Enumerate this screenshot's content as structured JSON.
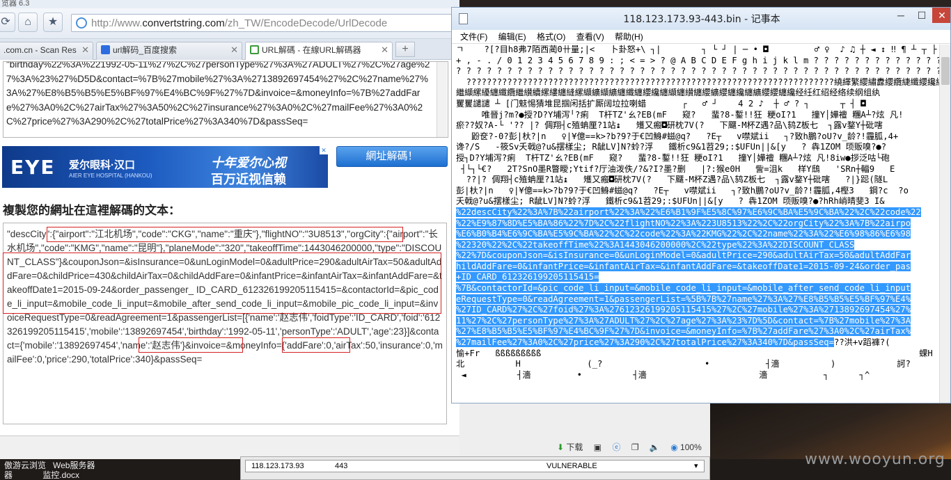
{
  "browser": {
    "window_title": "览器 6.3",
    "address_url_prefix": "http://www.",
    "address_url_domain": "convertstring.com",
    "address_url_path": "/zh_TW/EncodeDecode/UrlDecode",
    "tabs": [
      {
        "label": ".com.cn - Scan Res",
        "active": false
      },
      {
        "label": "url解码_百度搜索",
        "active": false
      },
      {
        "label": "URL解碼 - 在線URL解碼器",
        "active": true
      }
    ],
    "new_tab_label": "+",
    "top_textarea_text": "\"birthday%22%3A%221992-05-11%27%2C%27personType%27%3A%27ADULT%27%2C%27age%27%3A%23%27%D5D&contact=%7B%27mobile%27%3A%2713892697454%27%2C%27name%27%3A%27%E8%B5%B5%E5%BF%97%E4%BC%9F%27%7D&invoice=&moneyInfo=%7B%27addFare%27%3A0%2C%27airTax%27%3A50%2C%27insurance%27%3A0%2C%27mailFee%27%3A0%2C%27price%27%3A290%2C%27totalPrice%27%3A340%7D&passSeq=",
    "decode_button": "網址解碼！",
    "heading": "複製您的網址在這裡解碼的文本：",
    "result_text": "\"descCity\":{\"airport\":\"江北机场\",\"code\":\"CKG\",\"name\":\"重庆\"},\"flightNO\":\"3U8513\",\"orgCity\":{\"airport\":\"长水机场\",\"code\":\"KMG\",\"name\":\"昆明\"},\"planeMode\":\"320\",\"takeoffTime\":1443046200000,\"type\":\"DISCOUNT_CLASS\"}&couponJson=&isInsurance=0&unLoginModel=0&adultPrice=290&adultAirTax=50&adultAddFare=0&childPrice=430&childAirTax=0&childAddFare=0&infantPrice=&infantAirTax=&infantAddFare=&takeoffDate1=2015-09-24&order_passenger_ ID_CARD_612326199205115415=&contactorId=&pic_code_li_input=&mobile_code_li_input=&mobile_after_send_code_li_input=&mobile_pic_code_li_input=&invoiceRequestType=0&readAgreement=1&passengerList=[{'name':'赵志伟','foidType':'ID_CARD','foid':'612326199205115415','mobile':'13892697454','birthday':'1992-05-11','personType':'ADULT','age':23}]&contact={'mobile':'13892697454','name':'赵志伟'}&invoice=&moneyInfo={'addFare':0,'airTax':50,'insurance':0,'mailFee':0,'price':290,'totalPrice':340}&passSeq=",
    "status_download": "下载",
    "status_zoom": "100%"
  },
  "banner": {
    "logo": "EYE",
    "name_cn": "爱尔眼科·汉口",
    "name_en": "AIER EYE HOSPITAL (HANKOU)",
    "slogan1": "十年爱尔心视",
    "slogan2": "百万近视信赖",
    "ad_mark": "✕"
  },
  "notepad": {
    "title": "118.123.173.93-443.bin - 记事本",
    "menu": [
      "文件(F)",
      "编辑(E)",
      "格式(O)",
      "查看(V)",
      "帮助(H)"
    ],
    "lines": [
      {
        "text": "ㄱ    ?[?目h8弗7陌西蔺0卄量;|<   卜卦怒+\\ ┐|        ┐ └ ┘ | ─ • ◘         ♂ ♀  ♪ ♫ ┼ ◄ ↕ ‼ ¶ ┴ ┬ ├",
        "sel": false
      },
      {
        "text": "+ , - . / 0 1 2 3 4 5 6 7 8 9 : ; < = > ? @ A B C D E F g h i j k l m ? ? ? ? ? ? ? ? ? ? ? ? ?",
        "sel": false
      },
      {
        "text": "? ? ? ? ? ? ? ? ? ? ? ? ? ? ? ? ? ? ? ? ? ? ? ? ? ? ? ? ? ? ? ? ? ? ? ? ? ? ? ? ? ? ? ? ? ? ? ? ? ?",
        "sel": false
      },
      {
        "text": "  ????????????????????????????????????????????????????????????????????????繞繹繁纓繡纛纓纜緁纖纓纔纓纗",
        "sel": false
      },
      {
        "text": "繼纈縲纋纏纖纜繼纉續縲縷纏縫縲纈纊纈纊纏纖纏纓纔纏纈纏纉纏纓纊纓纏纔纏纊纓纓纏纔经纴红绍经络续纲组纨",
        "sel": false
      },
      {
        "text": "矍矍譴譴 ┴ [门鬾惕猜堆昆掴闲括扩厮阔垃拉喇蜡       ┌   ♂ ┘    4 2 ♪  ┼ ♂ ? ┐      ┬ ┤ ◘",
        "sel": false
      },
      {
        "text": "     唯晉j?m?●授?D?Y埔泻╵?痢  T杆TZ'ㄠ?EB(mF   窥?   蜚?8-鏨!!狂 粳oI?1   撞Y│嬅襢 糰A┴?炫 凡!",
        "sel": false
      },
      {
        "text": "瘀??奴?A-└ '?? |? 倜翔┤c殖蚺厘?1站↨   矱又瘢◘研枕7V(?   下飅-M杯Z遇?品\\鸫Z板七  ┐露v鍪Y┼砒嗐",
        "sel": false
      },
      {
        "text": "   鼢奁?-0?彭|杕?|n   ♀|¥億==k>?b?9?于€凹鯓#螆@q?   ?E┬   v噤斌ii   ┐?致h鵬?oU?v_龄?!霾胍,4+",
        "sel": false
      },
      {
        "text": "谗?/S   -筱Sv夭戟@?u&摆樣尘; R龇LV]N?蛉?浮   鐵析c9&1苕29;:$UFUn||&[y   ? 犇1ZOM ̄顷贩嗅?●?",
        "sel": false
      },
      {
        "text": "授┐D?Y埔泻?痢  T杆TZ'ㄠ?EB(mF   窥?   蜚?8-鏨!!狂 粳oI?1   撞Y│嬅襢 糰A┴?炫 凡!8iw●拶泛咕└砲",
        "sel": false
      },
      {
        "text": " ┤└┐└€?   2T?SnO墨R瞥瞹;Ytif?厅油泼佚/?&?I?墨?删   |?:猴e0H   訾=沮k   样Y鴟   'SRn┼輻9   E",
        "sel": false
      },
      {
        "text": "  ??|? 倜翔┤c殖蚺厘?1站↨   矱又瘢◘研枕7V(?   下飅-M杯Z遇?品\\鸫Z板七  ┐露v鍪Y┼砒嗐   ?|}跽(隧L",
        "sel": false
      },
      {
        "text": "彭|杕?|n   ♀|¥億==k>?b?9?于€凹鯓#螆@q?   ?E┬   v噤斌ii   ┐?致h鵬?oU?v_龄?!霾胍,4樫3   鋼?c  ?o",
        "sel": false
      },
      {
        "text": "夭戟@?u&摆樣尘; R龇LV]N?蛉?浮   鐵析c9&1苕29;:$UFUn||&[y   ? 犇1ZOM ̄顷贩嗅?●?hRh峭晴斐3 I&",
        "sel": false
      },
      {
        "text": "%22descCity%22%3A%7B%22airport%22%3A%22%E6%B1%9F%E5%8C%97%E6%9C%BA%E5%9C%BA%22%2C%22code%22",
        "sel": true
      },
      {
        "text": "%22%E9%87%8D%E5%BA%86%22%7D%2C%22flightNO%22%3A%223U8513%22%2C%22orgCity%22%3A%7B%22airpo",
        "sel": true
      },
      {
        "text": "%E6%B0%B4%E6%9C%BA%E5%9C%BA%22%2C%22code%22%3A%22KMG%22%2C%22name%22%3A%22%E6%98%86%E6%98",
        "sel": true
      },
      {
        "text": "%22320%22%2C%22takeoffTime%22%3A1443046200000%2C%22type%22%3A%22DISCOUNT_CLASS",
        "sel": true
      },
      {
        "text": "%22%7D&couponJson=&isInsurance=0&unLoginModel=0&adultPrice=290&adultAirTax=50&adultAddFar",
        "sel": true
      },
      {
        "text": "hildAddFare=0&infantPrice=&infantAirTax=&infantAddFare=&takeoffDate1=2015-09-24&order_pas",
        "sel": true
      },
      {
        "text": "+ID_CARD_612326199205115415=",
        "sel": true
      },
      {
        "text": "%7B&contactorId=&pic_code_li_input=&mobile_code_li_input=&mobile_after_send_code_li_input",
        "sel": true
      },
      {
        "text": "eRequestType=0&readAgreement=1&passengerList=%5B%7B%27name%27%3A%27%E8%B5%B5%E5%BF%97%E4%",
        "sel": true
      },
      {
        "text": "%27ID_CARD%27%2C%27foid%27%3A%27612326199205115415%27%2C%27mobile%27%3A%2713892697454%27%",
        "sel": true
      },
      {
        "text": "11%27%2C%27personType%27%3A%27ADULT%27%2C%27age%27%3A%23%7D%5D&contact=%7B%27mobile%27%3A",
        "sel": true
      },
      {
        "text": "%27%E8%B5%B5%E5%BF%97%E4%BC%9F%27%7D&invoice=&moneyInfo=%7B%27addFare%27%3A0%2C%27airTax%",
        "sel": true
      },
      {
        "text": "%27mailFee%27%3A0%2C%27price%27%3A290%2C%27totalPrice%27%3A340%7D&passSeq=",
        "sel": true,
        "tail": "??洪+v蹈褲?("
      },
      {
        "text": "愉+Fr   ßßßßßßßßß                                                                          蜾H",
        "sel": false
      },
      {
        "text": "北          H             (_?                    •           ┤濇          )            訶?            ?",
        "sel": false
      },
      {
        "text": " ◄          ┤濇         •          ┤濇                      濇           ┐      ┐^",
        "sel": false
      }
    ]
  },
  "taskbar": {
    "labels_line1": "傲游云浏览   Web服务器",
    "labels_line2": "器             监控.docx"
  },
  "burp": {
    "host": "118.123.173.93",
    "port": "443",
    "status": "VULNERABLE"
  },
  "watermark": "www.wooyun.org"
}
